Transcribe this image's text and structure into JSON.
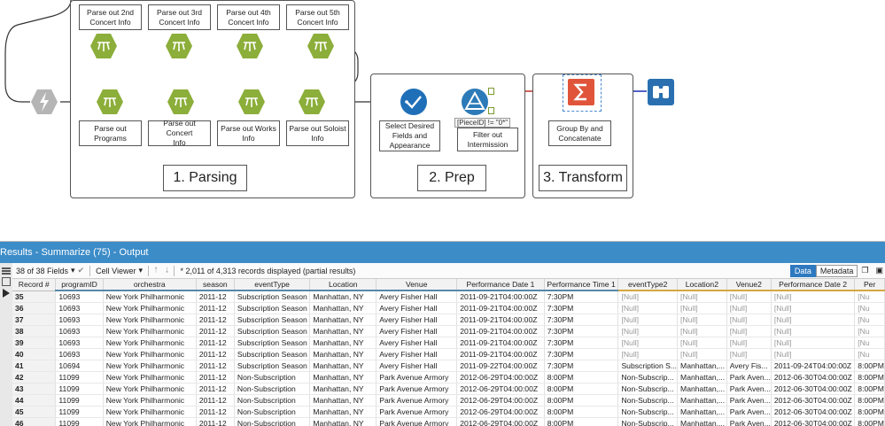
{
  "canvas": {
    "containers": [
      {
        "title": "1. Parsing"
      },
      {
        "title": "2. Prep"
      },
      {
        "title": "3. Transform"
      }
    ],
    "annotations": {
      "parse2": "Parse out 2nd\nConcert Info",
      "parse3": "Parse out 3rd\nConcert Info",
      "parse4": "Parse out 4th\nConcert Info",
      "parse5": "Parse out 5th\nConcert Info",
      "programs": "Parse out\nPrograms",
      "concert": "Parse out Concert\nInfo",
      "works": "Parse out Works\nInfo",
      "soloist": "Parse out Soloist\nInfo",
      "select": "Select Desired\nFields and\nAppearance",
      "filter": "Filter out\nIntermission",
      "summarize": "Group By and\nConcatenate"
    },
    "filter_expression": "[PieceID] != \"0*\"",
    "colors": {
      "parse_tool": "#8cae3a",
      "select_tool": "#1f6fb8",
      "filter_tool": "#2c7ab8",
      "summarize_tool": "#e0553a",
      "browse_tool": "#2a6fb0",
      "container_border": "#555555"
    }
  },
  "results": {
    "title": "Results - Summarize (75) - Output",
    "fields_selector": "38 of 38 Fields",
    "cell_viewer": "Cell Viewer",
    "status": "* 2,011 of 4,313 records displayed (partial results)",
    "data_tab": "Data",
    "metadata_tab": "Metadata",
    "columns": [
      "Record #",
      "programID",
      "orchestra",
      "season",
      "eventType",
      "Location",
      "Venue",
      "Performance Date 1",
      "Performance Time 1",
      "eventType2",
      "Location2",
      "Venue2",
      "Performance Date 2",
      "Per"
    ],
    "rows": [
      [
        "35",
        "10693",
        "New York Philharmonic",
        "2011-12",
        "Subscription Season",
        "Manhattan, NY",
        "Avery Fisher Hall",
        "2011-09-21T04:00:00Z",
        "7:30PM",
        "[Null]",
        "[Null]",
        "[Null]",
        "[Null]",
        "[Nu"
      ],
      [
        "36",
        "10693",
        "New York Philharmonic",
        "2011-12",
        "Subscription Season",
        "Manhattan, NY",
        "Avery Fisher Hall",
        "2011-09-21T04:00:00Z",
        "7:30PM",
        "[Null]",
        "[Null]",
        "[Null]",
        "[Null]",
        "[Nu"
      ],
      [
        "37",
        "10693",
        "New York Philharmonic",
        "2011-12",
        "Subscription Season",
        "Manhattan, NY",
        "Avery Fisher Hall",
        "2011-09-21T04:00:00Z",
        "7:30PM",
        "[Null]",
        "[Null]",
        "[Null]",
        "[Null]",
        "[Nu"
      ],
      [
        "38",
        "10693",
        "New York Philharmonic",
        "2011-12",
        "Subscription Season",
        "Manhattan, NY",
        "Avery Fisher Hall",
        "2011-09-21T04:00:00Z",
        "7:30PM",
        "[Null]",
        "[Null]",
        "[Null]",
        "[Null]",
        "[Nu"
      ],
      [
        "39",
        "10693",
        "New York Philharmonic",
        "2011-12",
        "Subscription Season",
        "Manhattan, NY",
        "Avery Fisher Hall",
        "2011-09-21T04:00:00Z",
        "7:30PM",
        "[Null]",
        "[Null]",
        "[Null]",
        "[Null]",
        "[Nu"
      ],
      [
        "40",
        "10693",
        "New York Philharmonic",
        "2011-12",
        "Subscription Season",
        "Manhattan, NY",
        "Avery Fisher Hall",
        "2011-09-21T04:00:00Z",
        "7:30PM",
        "[Null]",
        "[Null]",
        "[Null]",
        "[Null]",
        "[Nu"
      ],
      [
        "41",
        "10694",
        "New York Philharmonic",
        "2011-12",
        "Subscription Season",
        "Manhattan, NY",
        "Avery Fisher Hall",
        "2011-09-22T04:00:00Z",
        "7:30PM",
        "Subscription S...",
        "Manhattan,...",
        "Avery Fis...",
        "2011-09-24T04:00:00Z",
        "8:00PM"
      ],
      [
        "42",
        "11099",
        "New York Philharmonic",
        "2011-12",
        "Non-Subscription",
        "Manhattan, NY",
        "Park Avenue Armory",
        "2012-06-29T04:00:00Z",
        "8:00PM",
        "Non-Subscrip...",
        "Manhattan,...",
        "Park Aven...",
        "2012-06-30T04:00:00Z",
        "8:00PM"
      ],
      [
        "43",
        "11099",
        "New York Philharmonic",
        "2011-12",
        "Non-Subscription",
        "Manhattan, NY",
        "Park Avenue Armory",
        "2012-06-29T04:00:00Z",
        "8:00PM",
        "Non-Subscrip...",
        "Manhattan,...",
        "Park Aven...",
        "2012-06-30T04:00:00Z",
        "8:00PM"
      ],
      [
        "44",
        "11099",
        "New York Philharmonic",
        "2011-12",
        "Non-Subscription",
        "Manhattan, NY",
        "Park Avenue Armory",
        "2012-06-29T04:00:00Z",
        "8:00PM",
        "Non-Subscrip...",
        "Manhattan,...",
        "Park Aven...",
        "2012-06-30T04:00:00Z",
        "8:00PM"
      ],
      [
        "45",
        "11099",
        "New York Philharmonic",
        "2011-12",
        "Non-Subscription",
        "Manhattan, NY",
        "Park Avenue Armory",
        "2012-06-29T04:00:00Z",
        "8:00PM",
        "Non-Subscrip...",
        "Manhattan,...",
        "Park Aven...",
        "2012-06-30T04:00:00Z",
        "8:00PM"
      ],
      [
        "46",
        "11099",
        "New York Philharmonic",
        "2011-12",
        "Non-Subscription",
        "Manhattan, NY",
        "Park Avenue Armory",
        "2012-06-29T04:00:00Z",
        "8:00PM",
        "Non-Subscrip...",
        "Manhattan,...",
        "Park Aven...",
        "2012-06-30T04:00:00Z",
        "8:00PM"
      ]
    ]
  }
}
